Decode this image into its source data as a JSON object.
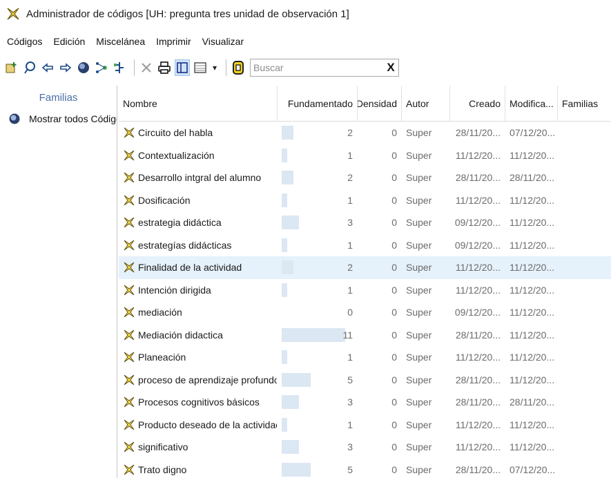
{
  "window": {
    "title": "Administrador de códigos [UH: pregunta tres unidad de observación 1]",
    "icon": "code-manager-icon"
  },
  "menubar": {
    "items": [
      "Códigos",
      "Edición",
      "Miscelánea",
      "Imprimir",
      "Visualizar"
    ]
  },
  "toolbar": {
    "buttons": [
      {
        "name": "new-code-icon",
        "glyph": "✚"
      },
      {
        "name": "comment-icon",
        "glyph": "⚲"
      },
      {
        "name": "back-icon",
        "glyph": "⇦"
      },
      {
        "name": "forward-icon",
        "glyph": "⇨"
      },
      {
        "name": "globe-icon",
        "glyph": "◕"
      },
      {
        "name": "network-icon",
        "glyph": "⋈"
      },
      {
        "name": "tree-icon",
        "glyph": "⊏"
      },
      {
        "name": "delete-icon",
        "glyph": "✕"
      },
      {
        "name": "print-icon",
        "glyph": "⎙"
      },
      {
        "name": "panel-toggle-icon",
        "glyph": "▥"
      },
      {
        "name": "view-options-icon",
        "glyph": "▦"
      },
      {
        "name": "dropdown-arrow-icon",
        "glyph": "▾"
      },
      {
        "name": "filter-icon",
        "glyph": "⬭"
      }
    ],
    "search": {
      "placeholder": "Buscar",
      "value": "",
      "clear_glyph": "X"
    }
  },
  "families": {
    "header": "Familias",
    "items": [
      {
        "label": "Mostrar todos Códigos",
        "icon": "families-all-icon"
      }
    ]
  },
  "table": {
    "columns": [
      "Nombre",
      "Fundamentado",
      "Densidad",
      "Autor",
      "Creado",
      "Modifica...",
      "Familias"
    ],
    "max_fundamentado": 11,
    "selected_row": 6,
    "rows": [
      {
        "nombre": "Circuito del habla",
        "fundamentado": 2,
        "densidad": 0,
        "autor": "Super",
        "creado": "28/11/20...",
        "modificado": "07/12/20...",
        "familias": ""
      },
      {
        "nombre": "Contextualización",
        "fundamentado": 1,
        "densidad": 0,
        "autor": "Super",
        "creado": "11/12/20...",
        "modificado": "11/12/20...",
        "familias": ""
      },
      {
        "nombre": "Desarrollo intgral del alumno",
        "fundamentado": 2,
        "densidad": 0,
        "autor": "Super",
        "creado": "28/11/20...",
        "modificado": "28/11/20...",
        "familias": ""
      },
      {
        "nombre": "Dosificación",
        "fundamentado": 1,
        "densidad": 0,
        "autor": "Super",
        "creado": "11/12/20...",
        "modificado": "11/12/20...",
        "familias": ""
      },
      {
        "nombre": "estrategia didáctica",
        "fundamentado": 3,
        "densidad": 0,
        "autor": "Super",
        "creado": "09/12/20...",
        "modificado": "11/12/20...",
        "familias": ""
      },
      {
        "nombre": "estrategías didácticas",
        "fundamentado": 1,
        "densidad": 0,
        "autor": "Super",
        "creado": "09/12/20...",
        "modificado": "11/12/20...",
        "familias": ""
      },
      {
        "nombre": "Finalidad de la actividad",
        "fundamentado": 2,
        "densidad": 0,
        "autor": "Super",
        "creado": "11/12/20...",
        "modificado": "11/12/20...",
        "familias": ""
      },
      {
        "nombre": "Intención dirigida",
        "fundamentado": 1,
        "densidad": 0,
        "autor": "Super",
        "creado": "11/12/20...",
        "modificado": "11/12/20...",
        "familias": ""
      },
      {
        "nombre": "mediación",
        "fundamentado": 0,
        "densidad": 0,
        "autor": "Super",
        "creado": "09/12/20...",
        "modificado": "11/12/20...",
        "familias": ""
      },
      {
        "nombre": "Mediación didactica",
        "fundamentado": 11,
        "densidad": 0,
        "autor": "Super",
        "creado": "28/11/20...",
        "modificado": "11/12/20...",
        "familias": ""
      },
      {
        "nombre": "Planeación",
        "fundamentado": 1,
        "densidad": 0,
        "autor": "Super",
        "creado": "11/12/20...",
        "modificado": "11/12/20...",
        "familias": ""
      },
      {
        "nombre": "proceso de aprendizaje profundo",
        "fundamentado": 5,
        "densidad": 0,
        "autor": "Super",
        "creado": "28/11/20...",
        "modificado": "11/12/20...",
        "familias": ""
      },
      {
        "nombre": "Procesos cognitivos básicos",
        "fundamentado": 3,
        "densidad": 0,
        "autor": "Super",
        "creado": "28/11/20...",
        "modificado": "28/11/20...",
        "familias": ""
      },
      {
        "nombre": "Producto deseado de la actividad",
        "fundamentado": 1,
        "densidad": 0,
        "autor": "Super",
        "creado": "11/12/20...",
        "modificado": "11/12/20...",
        "familias": ""
      },
      {
        "nombre": "significativo",
        "fundamentado": 3,
        "densidad": 0,
        "autor": "Super",
        "creado": "11/12/20...",
        "modificado": "11/12/20...",
        "familias": ""
      },
      {
        "nombre": "Trato digno",
        "fundamentado": 5,
        "densidad": 0,
        "autor": "Super",
        "creado": "28/11/20...",
        "modificado": "07/12/20...",
        "familias": ""
      }
    ]
  }
}
